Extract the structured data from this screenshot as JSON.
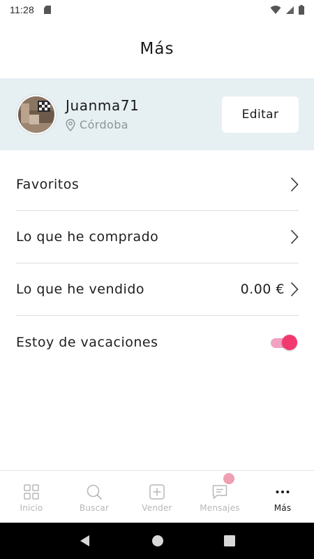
{
  "status_bar": {
    "time": "11:28"
  },
  "header": {
    "title": "Más"
  },
  "profile": {
    "username": "Juanma71",
    "location": "Córdoba",
    "edit_label": "Editar"
  },
  "menu": {
    "items": [
      {
        "label": "Favoritos"
      },
      {
        "label": "Lo que he comprado"
      },
      {
        "label": "Lo que he vendido",
        "value": "0.00 €"
      },
      {
        "label": "Estoy de vacaciones",
        "toggle_on": true
      }
    ]
  },
  "bottom_nav": {
    "items": [
      {
        "label": "Inicio",
        "icon": "grid-icon"
      },
      {
        "label": "Buscar",
        "icon": "search-icon"
      },
      {
        "label": "Vender",
        "icon": "plus-square-icon"
      },
      {
        "label": "Mensajes",
        "icon": "message-icon",
        "has_badge": true
      },
      {
        "label": "Más",
        "icon": "more-dots-icon",
        "active": true
      }
    ]
  },
  "colors": {
    "accent": "#f2396f",
    "profile_bg": "#e6eff2",
    "badge": "#ee9fb1",
    "inactive_nav": "#b7b7b7"
  }
}
